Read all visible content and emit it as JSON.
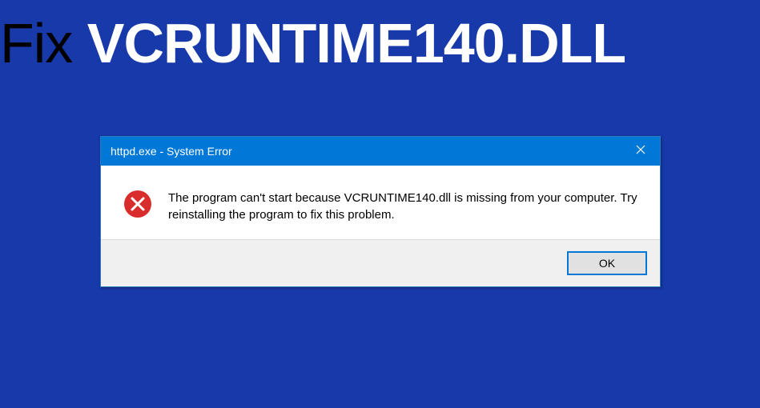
{
  "heading": {
    "fix": "Fix ",
    "dll": "VCRUNTIME140.DLL"
  },
  "dialog": {
    "title": "httpd.exe - System Error",
    "message": "The program can't start because VCRUNTIME140.dll is missing from your computer. Try reinstalling the program to fix this problem.",
    "ok_label": "OK"
  }
}
